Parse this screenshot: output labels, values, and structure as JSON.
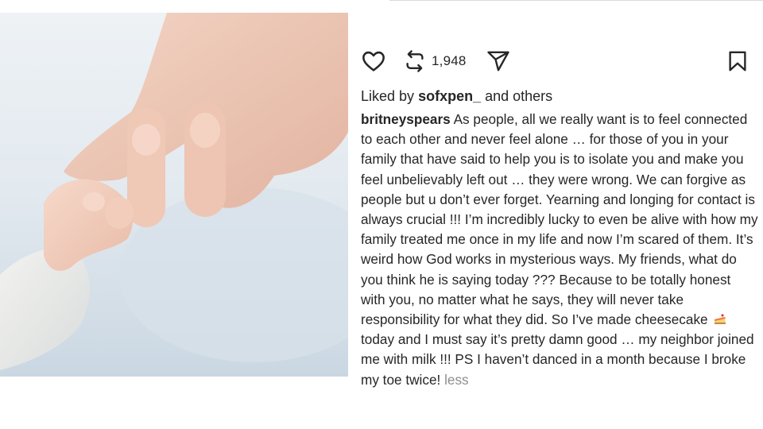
{
  "post": {
    "share_count": "1,948",
    "liked_by_prefix": "Liked by",
    "liked_by_user": "sofxpen_",
    "liked_by_suffix": "and others",
    "caption_user": "britneyspears",
    "caption_part1": "As people, all we really want is to feel connected to each other and never feel alone … for those of you in your family that have said to help you is to isolate you and make you feel unbelievably left out … they were wrong. We can forgive as people but u don’t ever forget. Yearning and longing for contact is always crucial !!! I’m incredibly lucky to even be alive with how my family treated me once in my life and now I’m scared of them. It’s weird how God works in mysterious ways. My friends, what do you think he is saying today ??? Because to be totally honest with you, no matter what he says, they will never take responsibility for what they did. So I’ve made cheesecake",
    "caption_part2": "today and I must say it’s pretty damn good … my neighbor joined me with milk !!! PS I haven’t danced in a month because I broke my toe twice!",
    "less_label": "less"
  },
  "icons": {
    "like": "heart-icon",
    "repost": "repost-icon",
    "share": "send-icon",
    "save": "bookmark-icon",
    "cheesecake": "cheesecake-emoji-icon"
  },
  "colors": {
    "text": "#262626",
    "muted": "#8e8e8e"
  }
}
